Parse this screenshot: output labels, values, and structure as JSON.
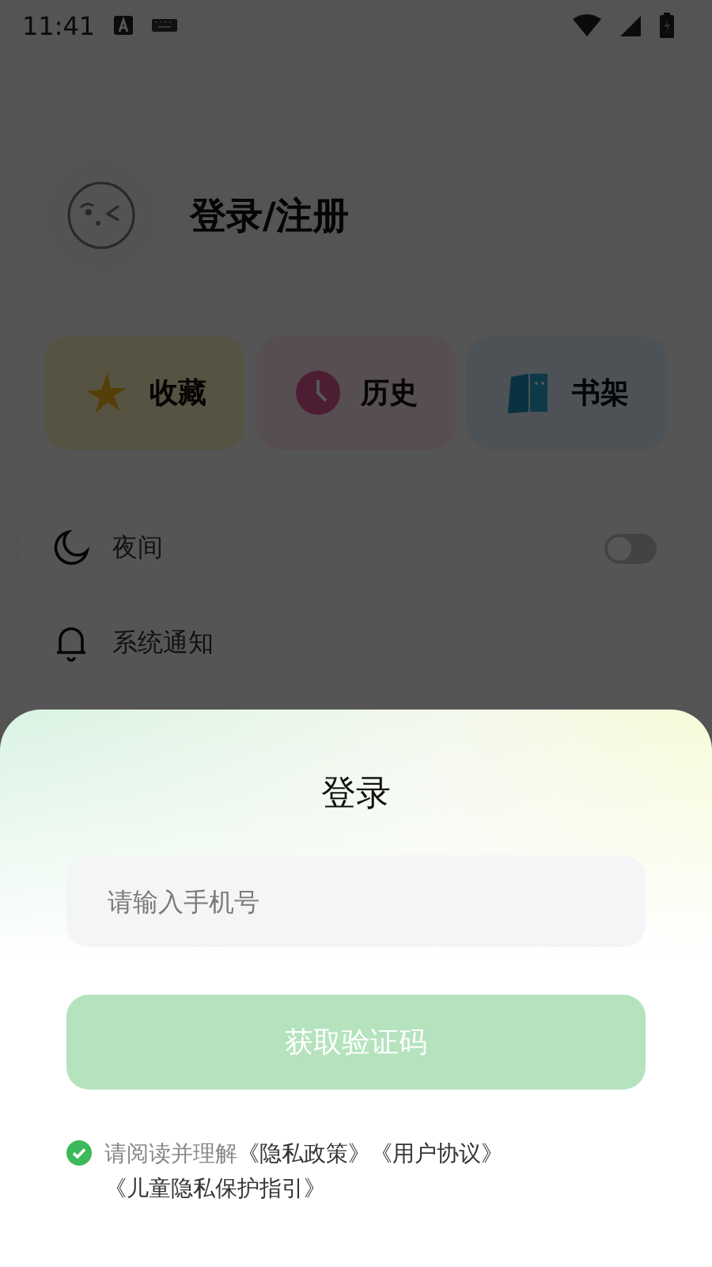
{
  "status_bar": {
    "time": "11:41"
  },
  "profile": {
    "name": "登录/注册"
  },
  "shortcuts": [
    {
      "kind": "favorites",
      "label": "收藏"
    },
    {
      "kind": "history",
      "label": "历史"
    },
    {
      "kind": "shelf",
      "label": "书架"
    }
  ],
  "settings": [
    {
      "kind": "toggle",
      "label": "夜间",
      "on": false
    },
    {
      "kind": "plain",
      "label": "系统通知"
    }
  ],
  "login_sheet": {
    "title": "登录",
    "phone_field": {
      "placeholder": "请输入手机号"
    },
    "submit": {
      "label": "获取验证码",
      "disabled": true
    },
    "agreement": {
      "checked": true,
      "text": "请阅读并理解",
      "links": [
        "《隐私政策》",
        "《用户协议》",
        "《儿童隐私保护指引》"
      ]
    }
  }
}
